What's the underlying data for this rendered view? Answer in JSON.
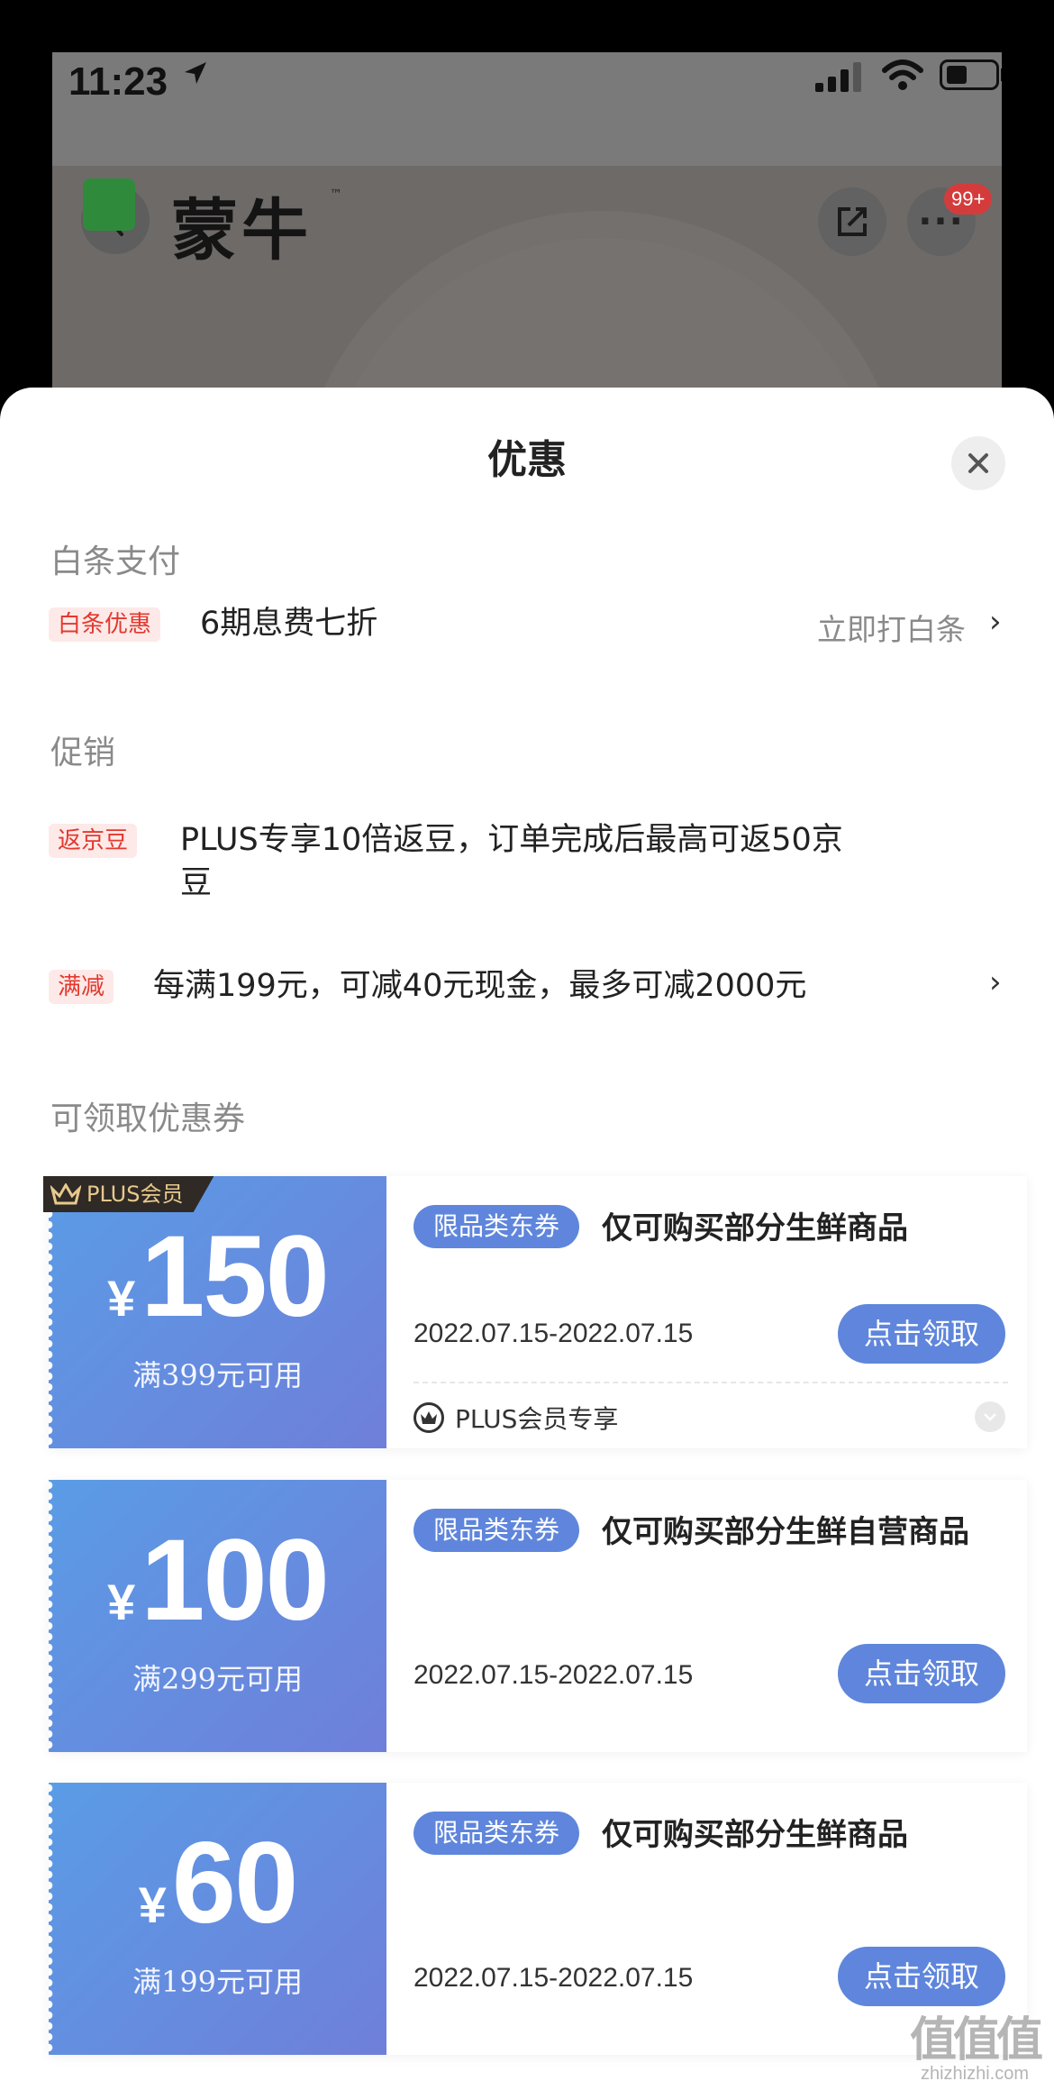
{
  "status_bar": {
    "time": "11:23"
  },
  "app_header": {
    "brand": "蒙牛",
    "trademark": "™",
    "notification_badge": "99+"
  },
  "sheet": {
    "title": "优惠",
    "baitiao": {
      "section_title": "白条支付",
      "tag": "白条优惠",
      "text": "6期息费七折",
      "action": "立即打白条",
      "chevron": "›"
    },
    "promotion": {
      "section_title": "促销",
      "items": [
        {
          "tag": "返京豆",
          "text_line1": "PLUS专享10倍返豆，订单完成后最高可返50京",
          "text_line2": "豆"
        },
        {
          "tag": "满减",
          "text": "每满199元，可减40元现金，最多可减2000元",
          "chevron": "›"
        }
      ]
    },
    "coupons": {
      "section_title": "可领取优惠券",
      "items": [
        {
          "ribbon": "PLUS会员",
          "currency": "¥",
          "amount": "150",
          "condition": "满399元可用",
          "category": "限品类东券",
          "description": "仅可购买部分生鲜商品",
          "date": "2022.07.15-2022.07.15",
          "button": "点击领取",
          "note": "PLUS会员专享"
        },
        {
          "currency": "¥",
          "amount": "100",
          "condition": "满299元可用",
          "category": "限品类东券",
          "description": "仅可购买部分生鲜自营商品",
          "date": "2022.07.15-2022.07.15",
          "button": "点击领取"
        },
        {
          "currency": "¥",
          "amount": "60",
          "condition": "满199元可用",
          "category": "限品类东券",
          "description": "仅可购买部分生鲜商品",
          "date": "2022.07.15-2022.07.15",
          "button": "点击领取"
        }
      ]
    }
  },
  "watermark": {
    "main": "值值值",
    "sub": "zhizhizhi.com"
  },
  "colors": {
    "coupon_gradient_start": "#5a9ce6",
    "coupon_gradient_end": "#6f7fd9",
    "tag_red": "#e2392f",
    "pill_blue": "#5f86dc",
    "plus_gold": "#e8c98c"
  }
}
